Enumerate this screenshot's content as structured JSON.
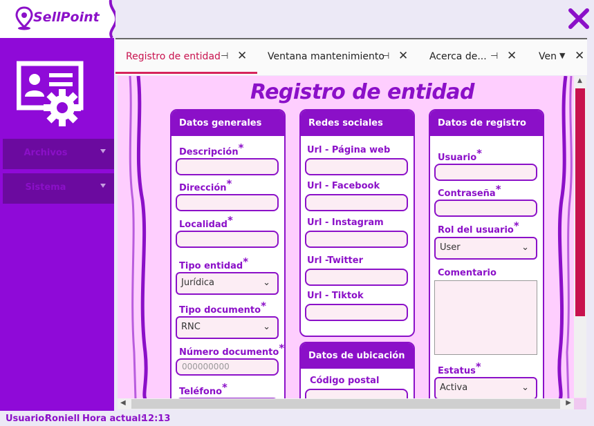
{
  "app": {
    "name": "SellPoint",
    "brand_color": "#8b10c8",
    "accent_color": "#c8124e",
    "sidebar_color": "#8f0ad8"
  },
  "sidebar": {
    "items": [
      {
        "label": "Archivos",
        "icon": "chevron-down-icon"
      },
      {
        "label": "Sistema",
        "icon": "chevron-down-icon"
      }
    ]
  },
  "tabs": [
    {
      "label": "Registro de entidad",
      "active": true
    },
    {
      "label": "Ventana mantenimiento",
      "active": false
    },
    {
      "label": "Acerca de...",
      "active": false
    },
    {
      "label": "Ven",
      "active": false
    }
  ],
  "form": {
    "title": "Registro de entidad",
    "datos_generales": {
      "header": "Datos generales",
      "descripcion": "Descripción",
      "direccion": "Dirección",
      "localidad": "Localidad",
      "tipo_entidad": "Tipo entidad",
      "tipo_entidad_value": "Jurídica",
      "tipo_documento": "Tipo documento",
      "tipo_documento_value": "RNC",
      "numero_documento": "Número documento",
      "numero_documento_placeholder": "000000000",
      "telefono": "Teléfono"
    },
    "redes_sociales": {
      "header": "Redes sociales",
      "web": "Url - Página web",
      "facebook": "Url - Facebook",
      "instagram": "Url - Instagram",
      "twitter": "Url -Twitter",
      "tiktok": "Url - Tiktok"
    },
    "datos_ubicacion": {
      "header": "Datos de ubicación",
      "codigo_postal": "Código postal"
    },
    "datos_registro": {
      "header": "Datos de registro",
      "usuario": "Usuario",
      "contrasena": "Contraseña",
      "rol": "Rol del usuario",
      "rol_value": "User",
      "comentario": "Comentario",
      "estatus": "Estatus",
      "estatus_value": "Activa"
    },
    "required_mark": "*"
  },
  "status": {
    "usuario_label": "Usuario:",
    "usuario_value": "Roniell",
    "hora_label": "Hora actual:",
    "hora_value": "12:13"
  }
}
